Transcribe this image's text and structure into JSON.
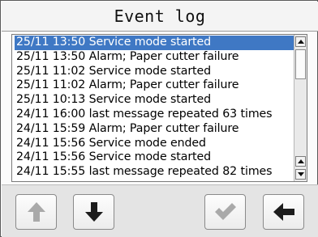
{
  "window": {
    "title": "Event log"
  },
  "log": {
    "selected_index": 0,
    "rows": [
      "25/11 13:50 Service mode started",
      "25/11 13:50 Alarm; Paper cutter failure",
      "25/11 11:02 Service mode started",
      "25/11 11:02 Alarm; Paper cutter failure",
      "25/11 10:13 Service mode started",
      "24/11 16:00 last message repeated 63 times",
      "24/11 15:59 Alarm; Paper cutter failure",
      "24/11 15:56 Service mode ended",
      "24/11 15:56 Service mode started",
      "24/11 15:55 last message repeated 82 times"
    ]
  },
  "toolbar": {
    "buttons": [
      {
        "icon": "arrow-up-icon",
        "enabled": false
      },
      {
        "icon": "arrow-down-icon",
        "enabled": true
      },
      {
        "icon": "checkmark-icon",
        "enabled": false
      },
      {
        "icon": "arrow-left-icon",
        "enabled": true
      }
    ]
  },
  "colors": {
    "selection": "#3f78c4",
    "icon_enabled": "#1c1c1c",
    "icon_disabled": "#a9a9a9"
  }
}
